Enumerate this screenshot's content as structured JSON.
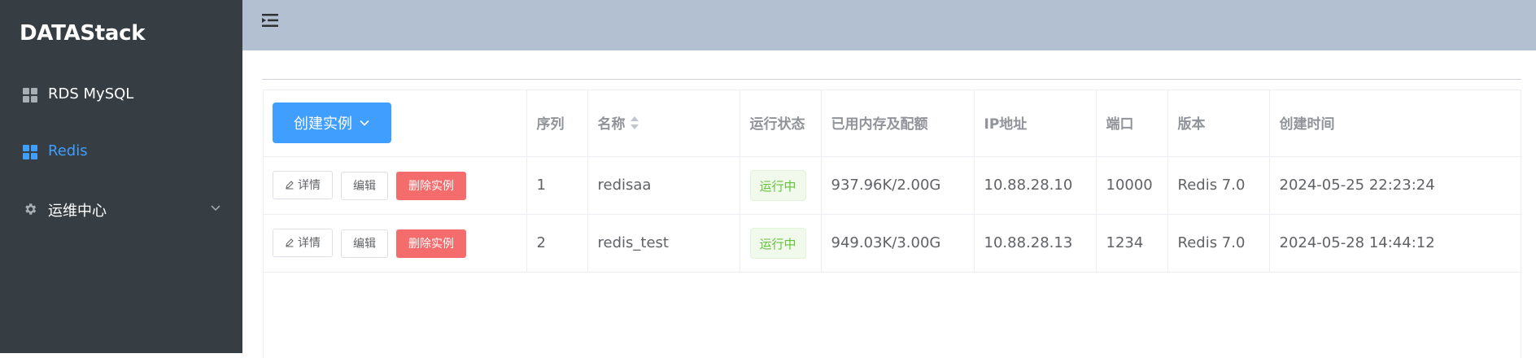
{
  "sidebar": {
    "brand": "DATAStack",
    "items": [
      {
        "label": "RDS MySQL",
        "icon": "grid-icon",
        "active": false
      },
      {
        "label": "Redis",
        "icon": "grid-icon",
        "active": true
      },
      {
        "label": "运维中心",
        "icon": "gear-icon",
        "active": false,
        "expandable": true
      }
    ]
  },
  "toolbar": {
    "create_label": "创建实例"
  },
  "table": {
    "columns": [
      "序列",
      "名称",
      "运行状态",
      "已用内存及配额",
      "IP地址",
      "端口",
      "版本",
      "创建时间"
    ],
    "actions": {
      "detail": "详情",
      "edit": "编辑",
      "delete": "删除实例"
    },
    "rows": [
      {
        "index": "1",
        "name": "redisaa",
        "status": "运行中",
        "memory": "937.96K/2.00G",
        "ip": "10.88.28.10",
        "port": "10000",
        "version": "Redis 7.0",
        "created": "2024-05-25 22:23:24"
      },
      {
        "index": "2",
        "name": "redis_test",
        "status": "运行中",
        "memory": "949.03K/3.00G",
        "ip": "10.88.28.13",
        "port": "1234",
        "version": "Redis 7.0",
        "created": "2024-05-28 14:44:12"
      }
    ]
  },
  "colors": {
    "sidebar_bg": "#363d43",
    "header_bg": "#b3c0d1",
    "primary": "#409eff",
    "danger": "#f56c6c",
    "success": "#67c23a"
  }
}
